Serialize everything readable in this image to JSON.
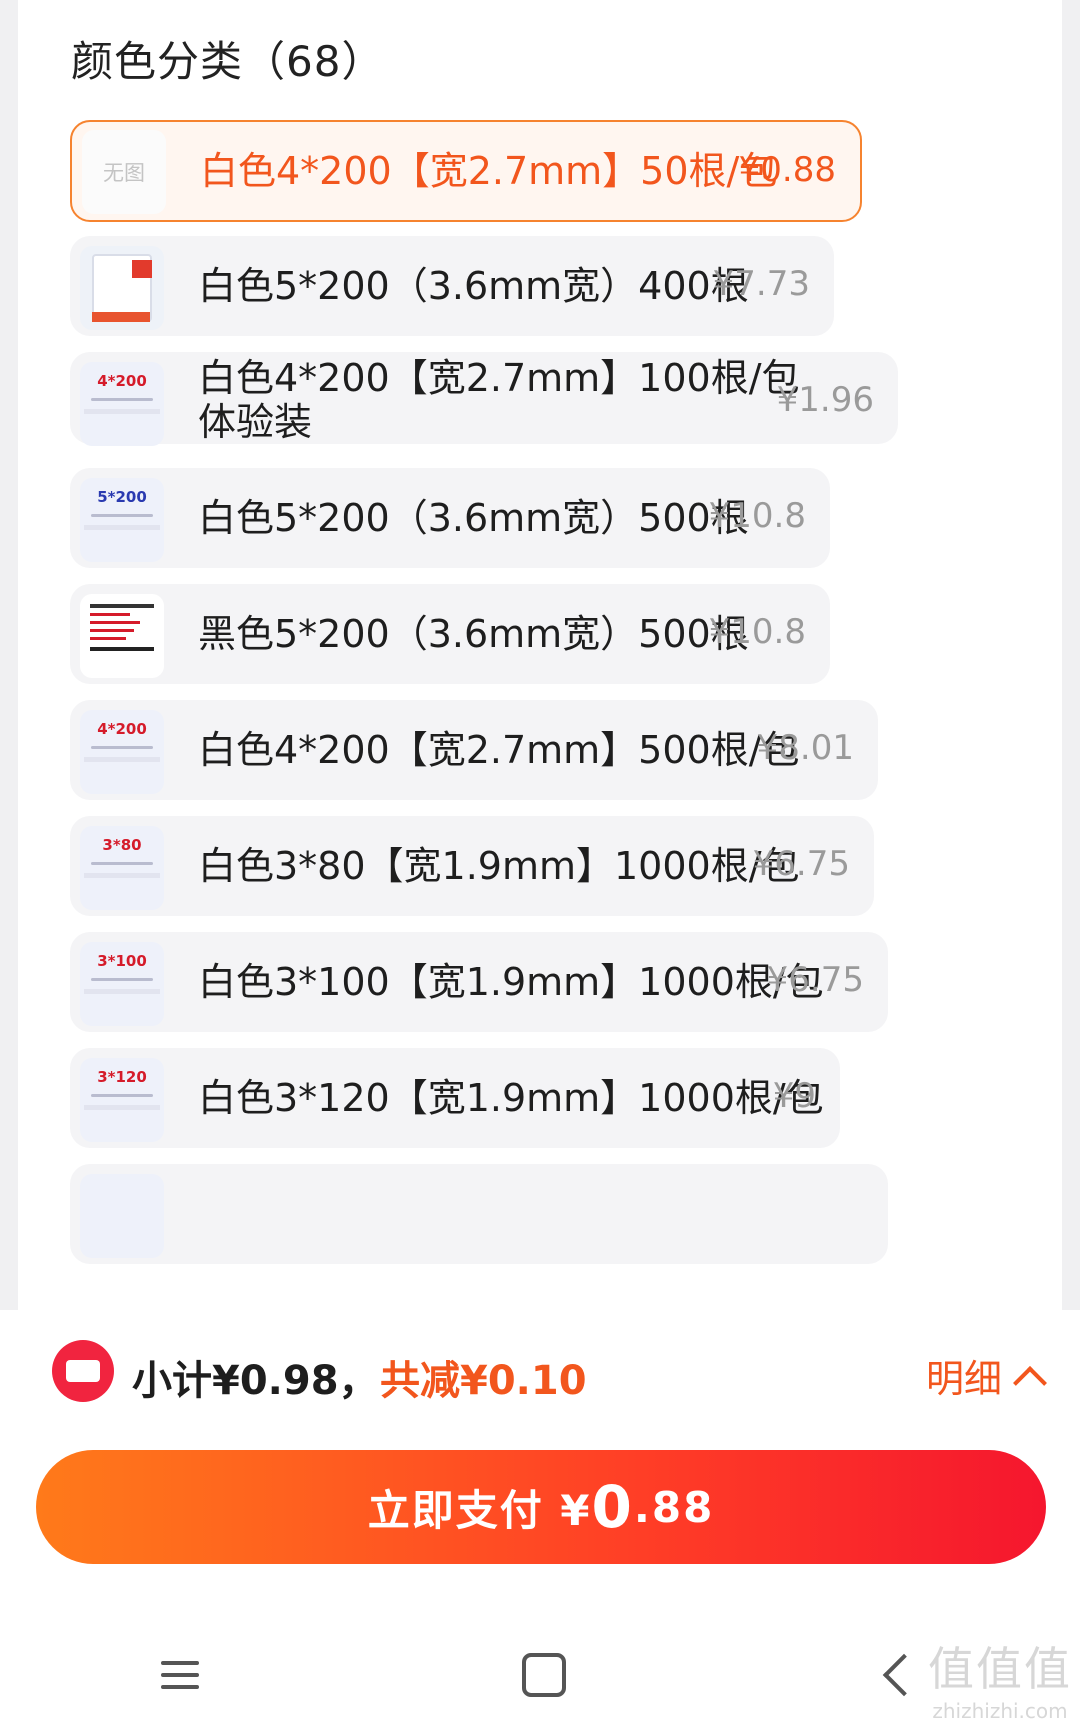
{
  "section_title": "颜色分类（68）",
  "options": [
    {
      "label": "白色4*200【宽2.7mm】50根/包",
      "price": "¥0.88",
      "selected": true,
      "thumb_text": "无图"
    },
    {
      "label": "白色5*200（3.6mm宽）400根",
      "price": "¥7.73",
      "thumb_text": ""
    },
    {
      "label": "白色4*200【宽2.7mm】100根/包 体验装",
      "label_line1": "白色4*200【宽2.7mm】100根/包",
      "label_line2": "体验装",
      "price": "¥1.96",
      "thumb_text": "4*200"
    },
    {
      "label": "白色5*200（3.6mm宽）500根",
      "price": "¥10.8",
      "thumb_text": "5*200"
    },
    {
      "label": "黑色5*200（3.6mm宽）500根",
      "price": "¥10.8",
      "thumb_text": ""
    },
    {
      "label": "白色4*200【宽2.7mm】500根/包",
      "price": "¥8.01",
      "thumb_text": "4*200"
    },
    {
      "label": "白色3*80【宽1.9mm】1000根/包",
      "price": "¥6.75",
      "thumb_text": "3*80"
    },
    {
      "label": "白色3*100【宽1.9mm】1000根/包",
      "price": "¥6.75",
      "thumb_text": "3*100"
    },
    {
      "label": "白色3*120【宽1.9mm】1000根/包",
      "price": "¥9",
      "thumb_text": "3*120"
    }
  ],
  "summary": {
    "subtotal": "小计¥0.98，",
    "discount": "共减¥0.10",
    "detail_label": "明细"
  },
  "pay_button": {
    "label": "立即支付 ¥",
    "amount_int": "0",
    "amount_dec": ".88"
  },
  "watermark": {
    "text": "值值值",
    "url": "zhizhizhi.com"
  },
  "colors": {
    "accent": "#f2561d",
    "coupon": "#f1243f"
  }
}
